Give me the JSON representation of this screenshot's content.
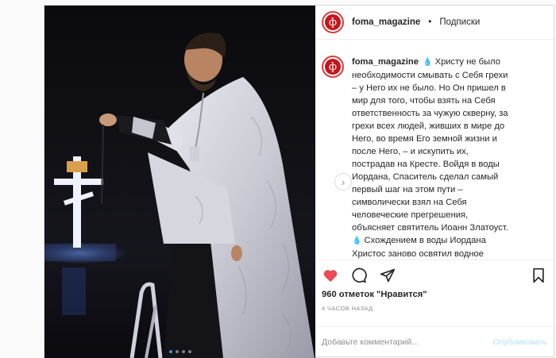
{
  "header": {
    "username": "foma_magazine",
    "separator": "•",
    "follow_label": "Подписки"
  },
  "logo_glyph": "ф",
  "caption": {
    "username": "foma_magazine",
    "emoji": "💧",
    "emoji2": "💧",
    "text1": " Христу не было необходимости смывать с Себя грехи – у Него их не было. Но Он пришел в мир для того, чтобы взять на Себя ответственность за чужую скверну, за грехи всех людей, живших в мире до Него, во время Его земной жизни и после Него, – и искупить их, пострадав на Кресте. Войдя в воды Иордана, Спаситель сделал самый первый шаг на этом пути – символически взял на Себя человеческие прегрешения, объясняет святитель Иоанн Златоуст.",
    "text2": " Схождением в воды Иордана Христос заново освятил водное естество, а через него – и всю сотворенную природу. Некогда грехопадение Адама и Евы"
  },
  "likes_text": "960 отметок \"Нравится\"",
  "time_text": "4 ЧАСОВ НАЗАД",
  "comment": {
    "placeholder": "Добавьте комментарий...",
    "publish_label": "Опубликовать"
  },
  "next_glyph": "›",
  "colors": {
    "like_red": "#ed4956",
    "brand_red": "#c4161c",
    "publish_disabled": "#b2dffc"
  },
  "carousel": {
    "total": 4,
    "active_index": 0
  }
}
